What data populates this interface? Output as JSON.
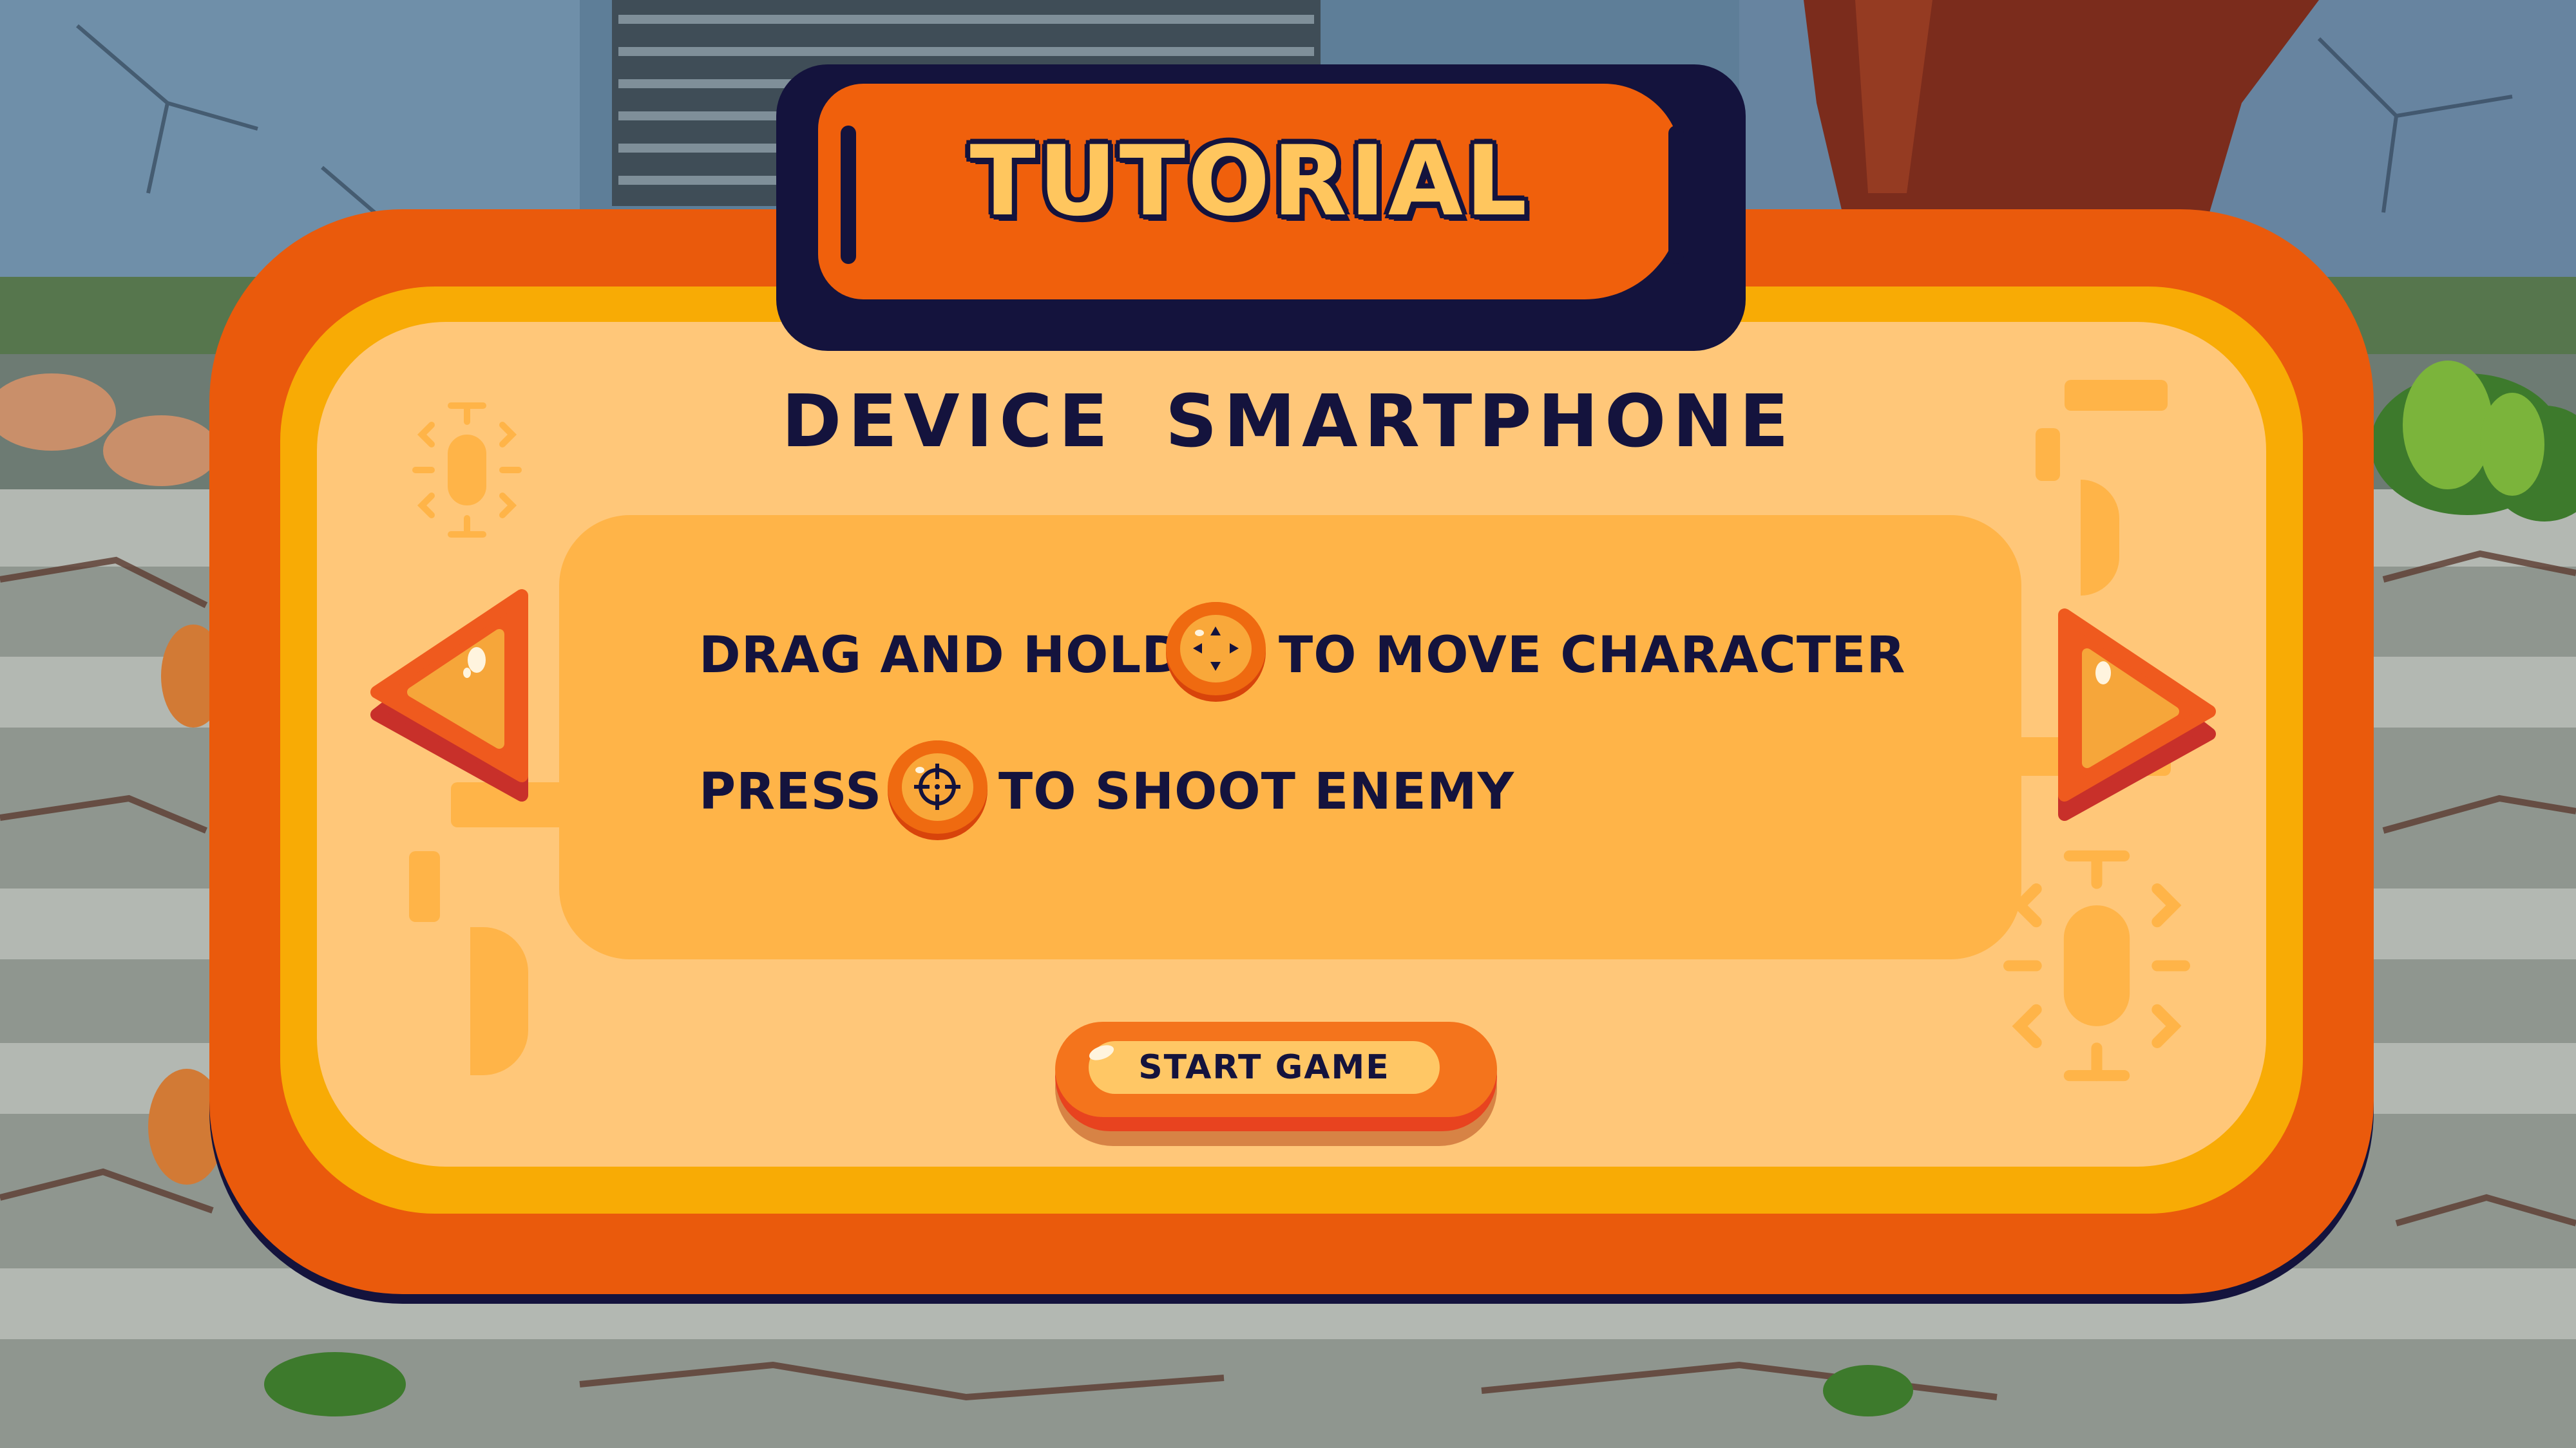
{
  "banner": {
    "title": "TUTORIAL"
  },
  "device": {
    "label": "DEVICE  SMARTPHONE"
  },
  "instructions": {
    "move_prefix": "DRAG AND HOLD",
    "move_suffix": "TO MOVE CHARACTER",
    "move_icon": "move-joystick-icon",
    "shoot_prefix": "PRESS",
    "shoot_suffix": "TO SHOOT ENEMY",
    "shoot_icon": "crosshair-icon"
  },
  "buttons": {
    "start_label": "START GAME",
    "prev_icon": "arrow-left-icon",
    "next_icon": "arrow-right-icon"
  },
  "colors": {
    "panel_orange": "#ea5a0c",
    "panel_ring": "#f8ab05",
    "panel_fill": "#ffc779",
    "content_fill": "#ffb448",
    "ink": "#14133d",
    "title_text": "#ffc65e"
  }
}
